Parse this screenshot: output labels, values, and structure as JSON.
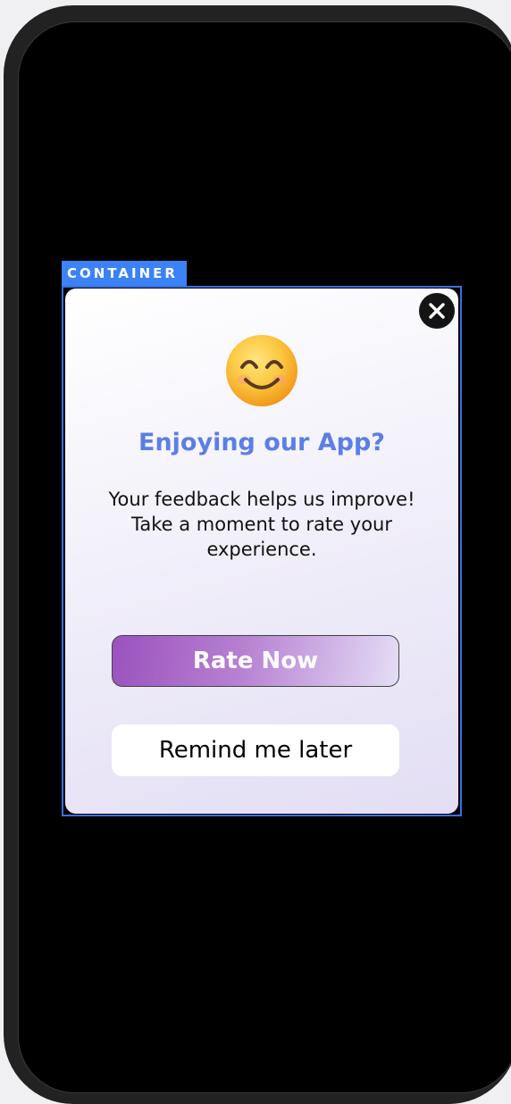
{
  "inspector": {
    "container_label": "CONTAINER",
    "outline_color": "#3b6fe0",
    "tag_color": "#3b82f6"
  },
  "dialog": {
    "close_icon": "close-icon",
    "emoji_icon": "smiling-face-emoji-icon",
    "title": "Enjoying our App?",
    "message": "Your feedback helps us improve! Take a moment to rate your experience.",
    "rate_button_label": "Rate Now",
    "remind_button_label": "Remind me later",
    "title_color": "#5b7fe6"
  }
}
